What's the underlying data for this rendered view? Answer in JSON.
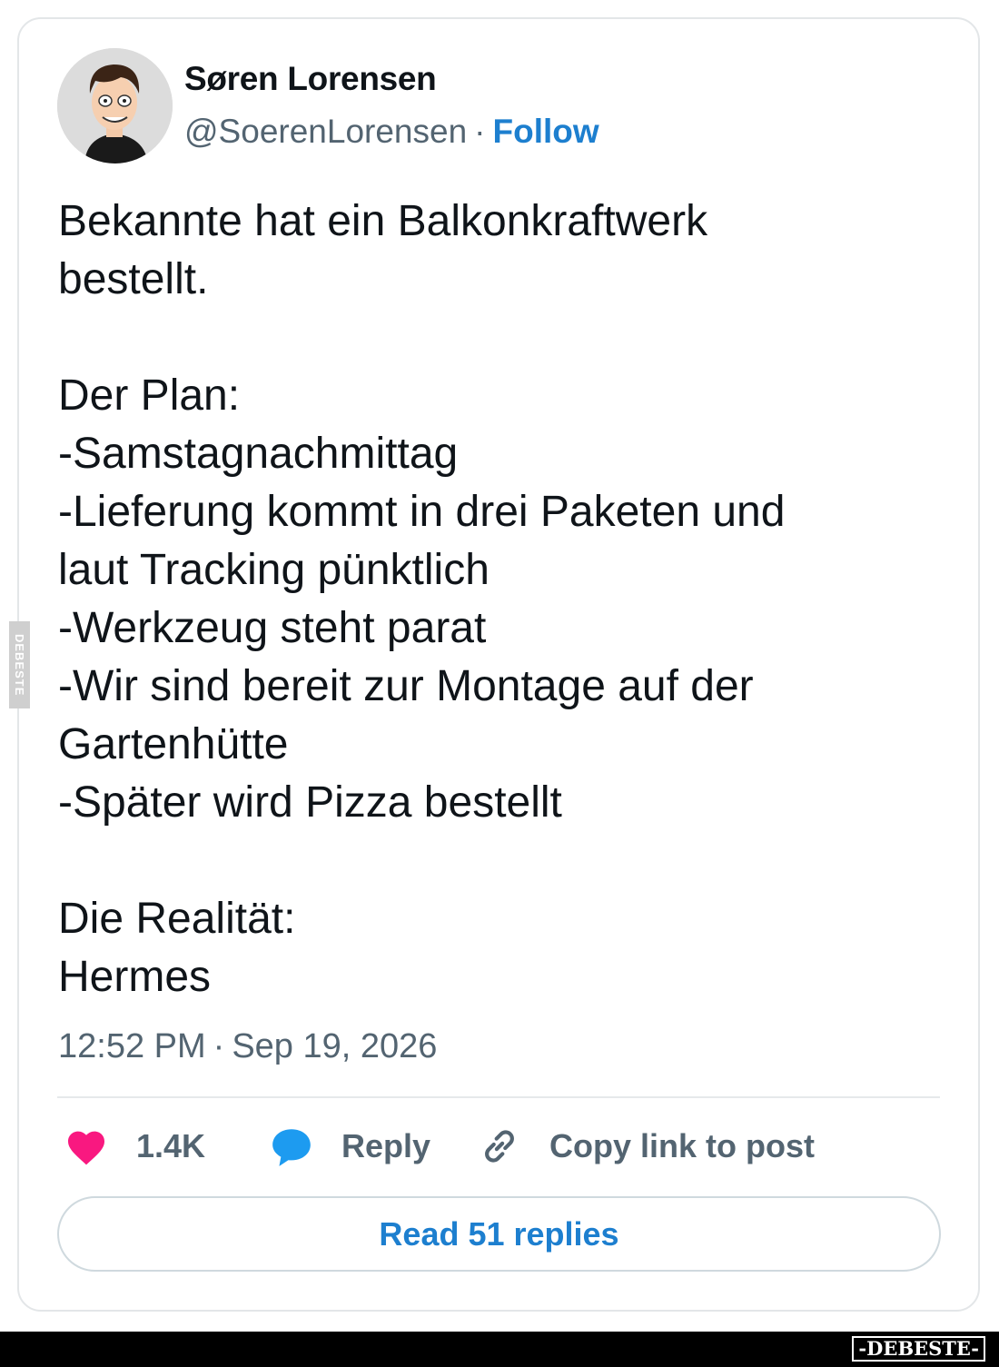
{
  "author": {
    "display_name": "Søren Lorensen",
    "handle": "@SoerenLorensen",
    "separator": "·",
    "follow_label": "Follow"
  },
  "tweet": {
    "text": "Bekannte hat ein Balkonkraftwerk\nbestellt.\n\nDer Plan:\n-Samstagnachmittag\n-Lieferung kommt in drei Paketen und\nlaut Tracking pünktlich\n-Werkzeug steht parat\n-Wir sind bereit zur Montage auf der\nGartenhütte\n-Später wird Pizza bestellt\n\nDie Realität:\nHermes",
    "time": "12:52 PM",
    "separator": "·",
    "date": "Sep 19, 2026"
  },
  "actions": {
    "like_count": "1.4K",
    "reply_label": "Reply",
    "copy_link_label": "Copy link to post"
  },
  "read_replies_label": "Read 51 replies",
  "watermark": {
    "side": "DEBESTE",
    "bottom": "-DEBESTE-"
  },
  "colors": {
    "like": "#f91880",
    "reply": "#1d9bf0",
    "link": "#1d7fcf",
    "secondary_text": "#536471"
  },
  "icons": {
    "like": "heart-icon",
    "reply": "speech-bubble-icon",
    "copy": "link-icon"
  }
}
